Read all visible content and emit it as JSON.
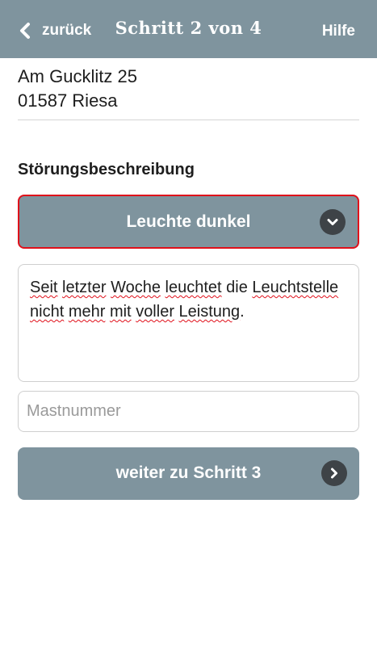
{
  "header": {
    "back_label": "zurück",
    "title": "Schritt 2 von 4",
    "help_label": "Hilfe"
  },
  "address": {
    "street": "Am Gucklitz 25",
    "city": "01587 Riesa"
  },
  "fault": {
    "section_label": "Störungsbeschreibung",
    "selected_value": "Leuchte dunkel",
    "description_words": [
      "Seit",
      "letzter",
      "Woche",
      "leuchtet",
      "die",
      "Leuchtstelle",
      "nicht",
      "mehr",
      "mit",
      "voller",
      "Leistung",
      "."
    ]
  },
  "mast": {
    "placeholder": "Mastnummer",
    "value": ""
  },
  "next": {
    "label": "weiter zu Schritt 3"
  },
  "colors": {
    "header_bg": "#7f949e",
    "accent_red": "#e0101a",
    "icon_circle": "#3e4347"
  },
  "icons": {
    "back": "chevron-left-icon",
    "dropdown": "chevron-down-circle-icon",
    "next": "chevron-right-circle-icon"
  }
}
